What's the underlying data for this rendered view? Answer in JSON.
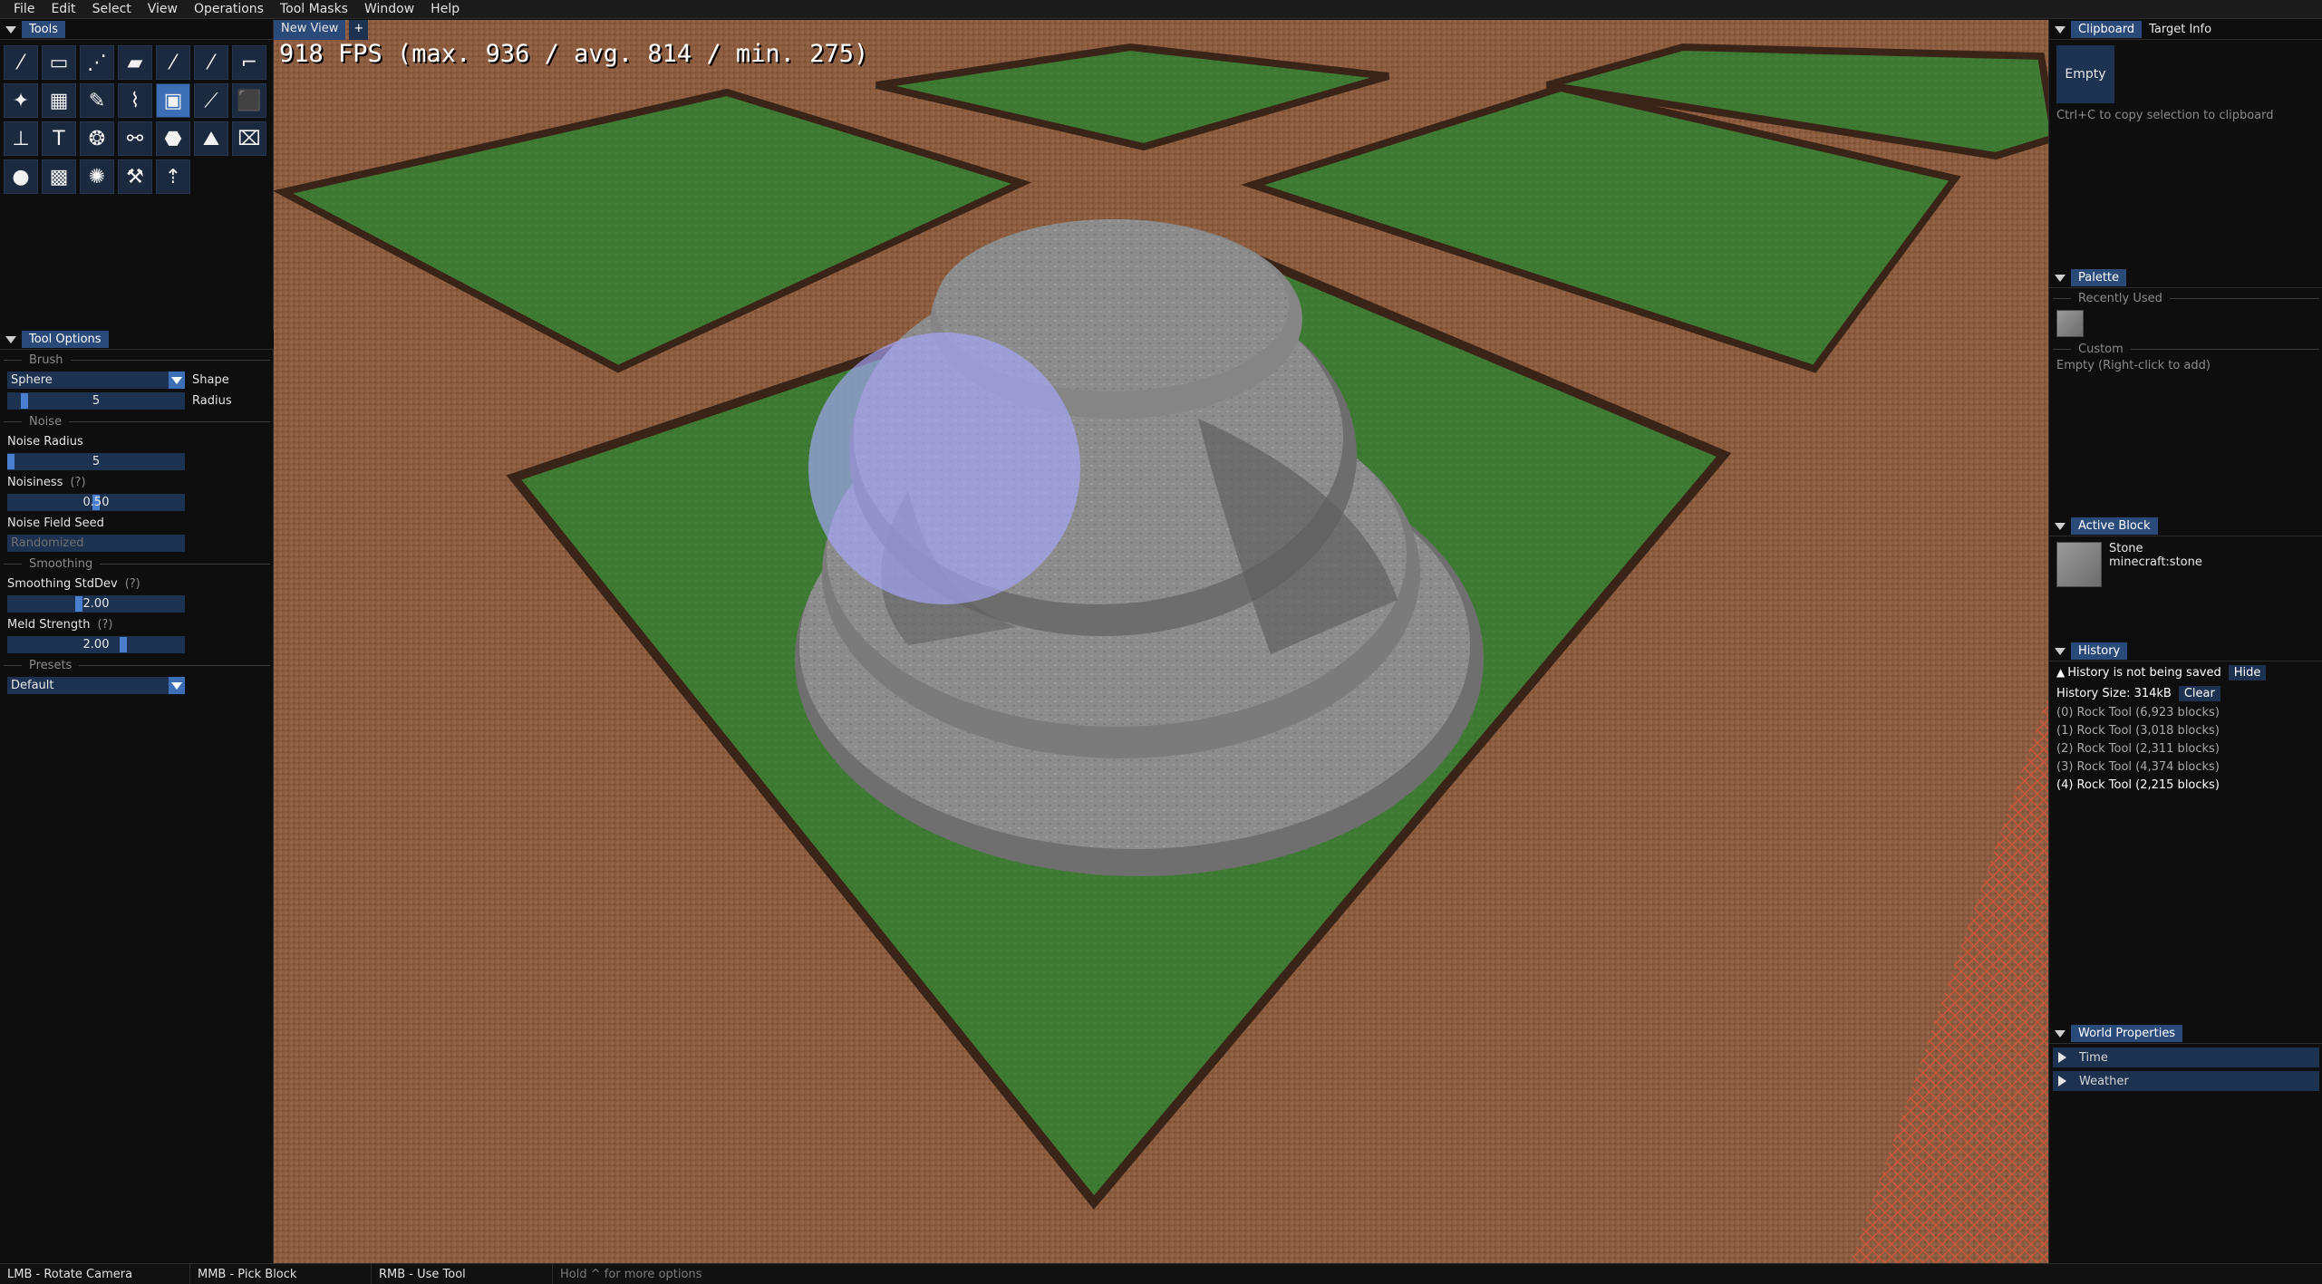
{
  "menu": [
    "File",
    "Edit",
    "Select",
    "View",
    "Operations",
    "Tool Masks",
    "Window",
    "Help"
  ],
  "tools_panel": {
    "title": "Tools",
    "icons": [
      "magic-wand-icon",
      "rect-select-icon",
      "eyedropper-line-icon",
      "ruler-icon",
      "brush-icon",
      "line-icon",
      "paint-roller-icon",
      "tree-icon",
      "checker-icon",
      "pencil-icon",
      "dropper-icon",
      "rock-tool-icon",
      "slope-icon",
      "cube-icon",
      "stamp-icon",
      "text-icon",
      "spheres-icon",
      "path-icon",
      "bucket-icon",
      "terrain-icon",
      "erase-icon",
      "circle-icon",
      "grid-icon",
      "burst-icon",
      "hammer-icon",
      "anchor-icon"
    ],
    "glyphs": [
      "⁄",
      "▭",
      "⋰",
      "▰",
      "⁄",
      "⁄",
      "⌐",
      "✦",
      "▦",
      "✎",
      "⌇",
      "▣",
      "⟋",
      "⬛",
      "⊥",
      "T",
      "❂",
      "⚯",
      "⬣",
      "⛰",
      "⌧",
      "●",
      "▩",
      "✺",
      "⚒",
      "⇡"
    ],
    "active_index": 11
  },
  "tool_options": {
    "title": "Tool Options",
    "brush_section": "Brush",
    "shape_value": "Sphere",
    "shape_label": "Shape",
    "radius_value": "5",
    "radius_label": "Radius",
    "radius_fraction": 0.08,
    "noise_section": "Noise",
    "noise_radius_label": "Noise Radius",
    "noise_radius_value": "5",
    "noise_radius_fraction": 0.0,
    "noisiness_label": "Noisiness",
    "noisiness_help": "(?)",
    "noisiness_value": "0.50",
    "noisiness_fraction": 0.5,
    "seed_label": "Noise Field Seed",
    "seed_placeholder": "Randomized",
    "smoothing_section": "Smoothing",
    "smoothing_label": "Smoothing StdDev",
    "smoothing_help": "(?)",
    "smoothing_value": "2.00",
    "smoothing_fraction": 0.4,
    "meld_label": "Meld Strength",
    "meld_help": "(?)",
    "meld_value": "2.00",
    "meld_fraction": 0.66,
    "presets_section": "Presets",
    "preset_value": "Default"
  },
  "viewport": {
    "tab_label": "New View",
    "add_tab": "+",
    "fps_text": "918 FPS (max. 936 / avg. 814 / min. 275)"
  },
  "right": {
    "clipboard_tab": "Clipboard",
    "target_info_tab": "Target Info",
    "clipboard_empty": "Empty",
    "clipboard_hint": "Ctrl+C to copy selection to clipboard",
    "palette_title": "Palette",
    "recently_used": "Recently Used",
    "custom": "Custom",
    "custom_empty": "Empty (Right-click to add)",
    "active_block_title": "Active Block",
    "block_name": "Stone",
    "block_id": "minecraft:stone",
    "history_title": "History",
    "history_warning": "History is not being saved",
    "hide_button": "Hide",
    "history_size": "History Size: 314kB",
    "clear_button": "Clear",
    "history_items": [
      "(0) Rock Tool (6,923 blocks)",
      "(1) Rock Tool (3,018 blocks)",
      "(2) Rock Tool (2,311 blocks)",
      "(3) Rock Tool (4,374 blocks)",
      "(4) Rock Tool (2,215 blocks)"
    ],
    "world_properties_title": "World Properties",
    "time_label": "Time",
    "weather_label": "Weather"
  },
  "status": [
    "LMB - Rotate Camera",
    "MMB - Pick Block",
    "RMB - Use Tool",
    "Hold ^ for more options"
  ],
  "colors": {
    "accent": "#3d6fb6",
    "panel_bg": "#0e0e0e",
    "field_bg": "#1d3151",
    "grass": "#3f7a34",
    "path": "#8b5a3c",
    "stone": "#8a8a8a",
    "brush_preview": "#a8a8ff"
  }
}
